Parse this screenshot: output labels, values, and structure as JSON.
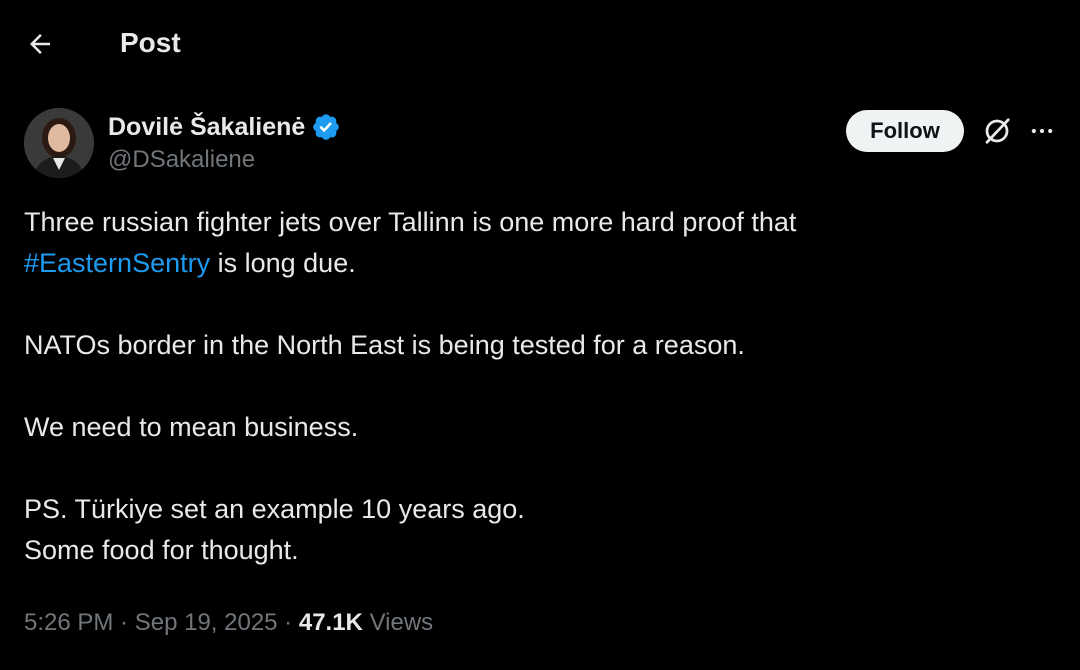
{
  "header": {
    "title": "Post",
    "back_icon": "arrow-left-icon"
  },
  "author": {
    "display_name": "Dovilė Šakalienė",
    "handle": "@DSakaliene",
    "verified": true,
    "verified_color": "#1d9bf0"
  },
  "actions": {
    "follow_label": "Follow",
    "grok_icon": "grok-icon",
    "more_icon": "more-horizontal-icon"
  },
  "tweet": {
    "line1_a": "Three russian fighter jets over Tallinn is one more hard proof that",
    "hashtag": "#EasternSentry",
    "line1_b": " is long due.",
    "para2": "NATOs border in the North East is being tested for a reason.",
    "para3": "We need to mean business.",
    "para4_line1": "PS. Türkiye set an example 10 years ago.",
    "para4_line2": "Some food for thought."
  },
  "meta": {
    "time": "5:26 PM",
    "separator": " · ",
    "date": "Sep 19, 2025",
    "views_count": "47.1K",
    "views_label": "Views"
  },
  "colors": {
    "background": "#000000",
    "text": "#e7e9ea",
    "secondary": "#71767b",
    "accent": "#1d9bf0"
  }
}
